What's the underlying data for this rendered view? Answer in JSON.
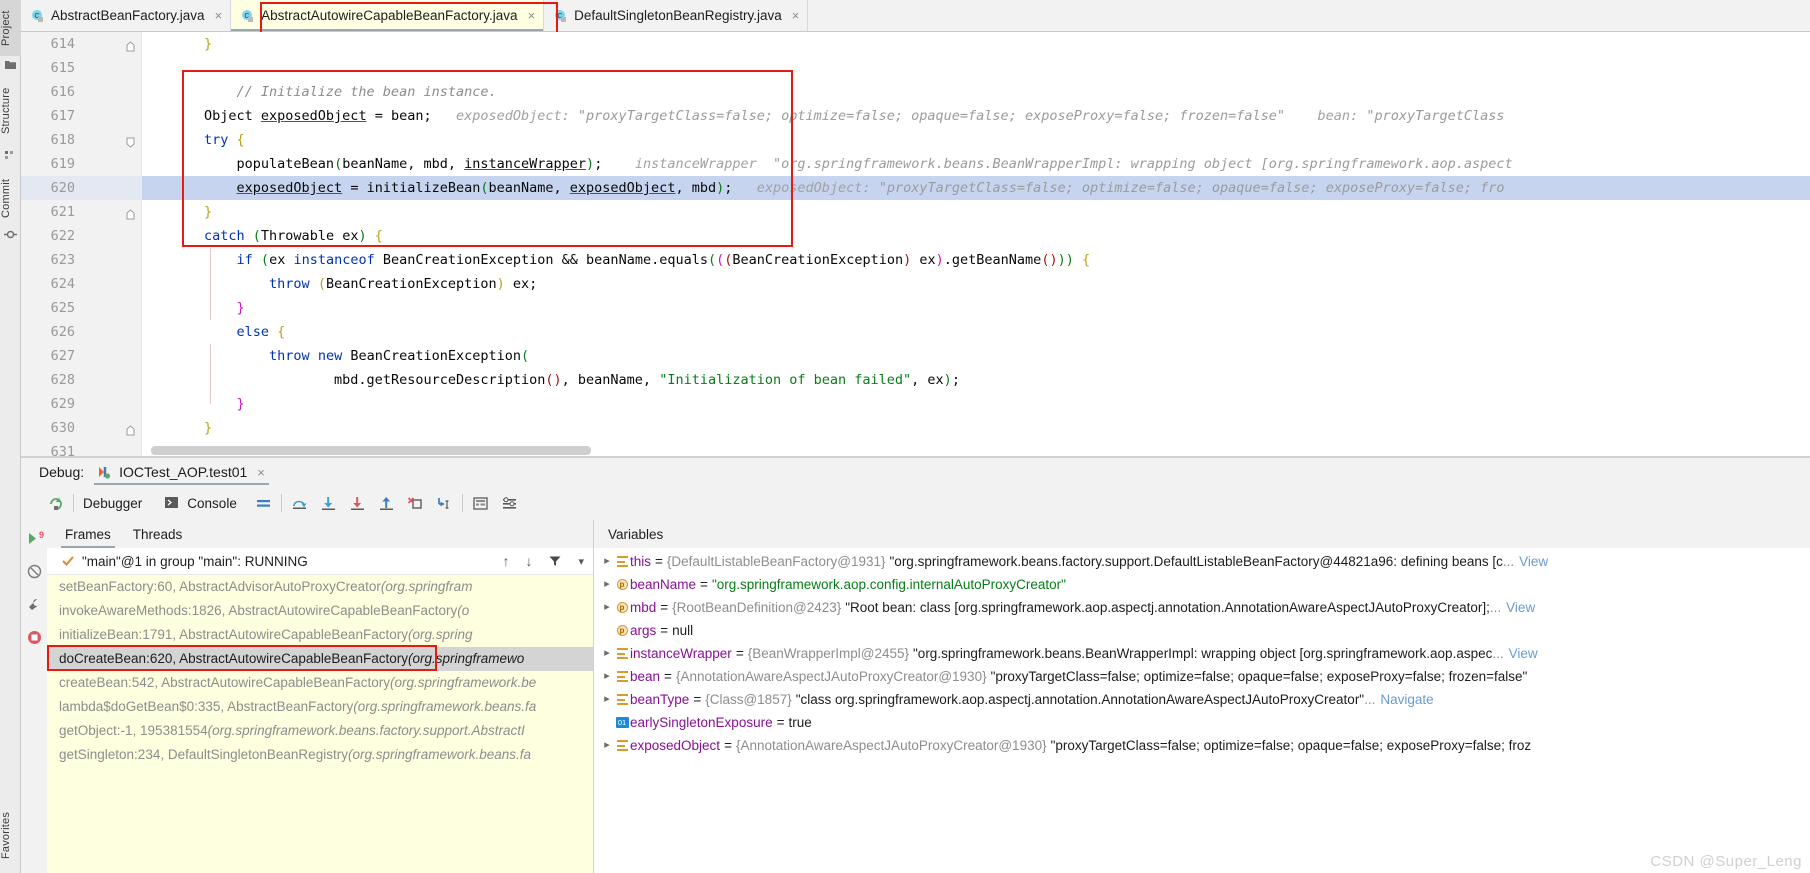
{
  "sidebar": {
    "tabs": [
      {
        "label": "Project",
        "icon": "folder-icon",
        "selected": true
      },
      {
        "label": "Structure",
        "icon": "structure-icon",
        "selected": false
      },
      {
        "label": "Commit",
        "icon": "commit-icon",
        "selected": false
      },
      {
        "label": "Favorites",
        "icon": "favorites-icon",
        "selected": false
      }
    ]
  },
  "editor": {
    "tabs": [
      {
        "label": "AbstractBeanFactory.java",
        "icon": "java-class-icon",
        "active": false,
        "close": "×"
      },
      {
        "label": "AbstractAutowireCapableBeanFactory.java",
        "icon": "java-class-icon",
        "active": true,
        "close": "×",
        "highlighted": true
      },
      {
        "label": "DefaultSingletonBeanRegistry.java",
        "icon": "java-class-icon",
        "active": false,
        "close": "×"
      }
    ],
    "line_numbers": [
      614,
      615,
      616,
      617,
      618,
      619,
      620,
      621,
      622,
      623,
      624,
      625,
      626,
      627,
      628,
      629,
      630,
      631
    ],
    "code_lines": [
      {
        "n": 614,
        "text": "    }"
      },
      {
        "n": 615,
        "text": ""
      },
      {
        "n": 616,
        "text": "    // Initialize the bean instance."
      },
      {
        "n": 617,
        "text": "    Object exposedObject = bean;"
      },
      {
        "n": 618,
        "text": "    try {"
      },
      {
        "n": 619,
        "text": "        populateBean(beanName, mbd, instanceWrapper);"
      },
      {
        "n": 620,
        "text": "        exposedObject = initializeBean(beanName, exposedObject, mbd);",
        "current": true
      },
      {
        "n": 621,
        "text": "    }"
      },
      {
        "n": 622,
        "text": "    catch (Throwable ex) {"
      },
      {
        "n": 623,
        "text": "        if (ex instanceof BeanCreationException && beanName.equals(((BeanCreationException) ex).getBeanName())) {"
      },
      {
        "n": 624,
        "text": "            throw (BeanCreationException) ex;"
      },
      {
        "n": 625,
        "text": "        }"
      },
      {
        "n": 626,
        "text": "        else {"
      },
      {
        "n": 627,
        "text": "            throw new BeanCreationException("
      },
      {
        "n": 628,
        "text": "                    mbd.getResourceDescription(), beanName, \"Initialization of bean failed\", ex);"
      },
      {
        "n": 629,
        "text": "        }"
      },
      {
        "n": 630,
        "text": "    }"
      },
      {
        "n": 631,
        "text": ""
      }
    ],
    "inline_hints": {
      "line617_a_name": "exposedObject:",
      "line617_a_value": "\"proxyTargetClass=false; optimize=false; opaque=false; exposeProxy=false; frozen=false\"",
      "line617_b_name": "bean:",
      "line617_b_value": "\"proxyTargetClass",
      "line619_name": "instanceWrapper",
      "line619_value": "\"org.springframework.beans.BeanWrapperImpl: wrapping object [org.springframework.aop.aspect",
      "line620_name": "exposedObject:",
      "line620_value": "\"proxyTargetClass=false; optimize=false; opaque=false; exposeProxy=false; fro"
    }
  },
  "debug": {
    "label": "Debug:",
    "run_config": "IOCTest_AOP.test01",
    "run_config_close": "×",
    "toolbar": {
      "rerun_icon": "rerun-icon",
      "tabs": [
        {
          "label": "Debugger",
          "icon": "debugger-icon",
          "selected": true
        },
        {
          "label": "Console",
          "icon": "console-icon",
          "selected": false
        }
      ],
      "actions": [
        {
          "name": "layout-icon",
          "title": "Layout Settings"
        },
        {
          "name": "step-over-icon",
          "title": "Step Over"
        },
        {
          "name": "step-into-icon",
          "title": "Step Into"
        },
        {
          "name": "force-step-into-icon",
          "title": "Force Step Into"
        },
        {
          "name": "step-out-icon",
          "title": "Step Out"
        },
        {
          "name": "drop-frame-icon",
          "title": "Drop Frame"
        },
        {
          "name": "run-to-cursor-icon",
          "title": "Run to Cursor"
        },
        {
          "name": "evaluate-expression-icon",
          "title": "Evaluate Expression"
        },
        {
          "name": "settings-icon",
          "title": "Settings"
        }
      ]
    },
    "left_rail": [
      {
        "name": "resume-program-icon"
      },
      {
        "name": "mute-breakpoints-icon"
      },
      {
        "name": "settings-wrench-icon"
      },
      {
        "name": "stop-icon"
      }
    ],
    "frames": {
      "tabs": [
        {
          "label": "Frames",
          "selected": true
        },
        {
          "label": "Threads",
          "selected": false
        }
      ],
      "thread": "\"main\"@1 in group \"main\": RUNNING",
      "thread_icon": "check-icon",
      "controls": [
        {
          "name": "move-up-icon",
          "glyph": "↑"
        },
        {
          "name": "move-down-icon",
          "glyph": "↓"
        },
        {
          "name": "filter-icon",
          "glyph": "filter"
        },
        {
          "name": "dropdown-icon",
          "glyph": "▾"
        }
      ],
      "items": [
        {
          "method": "setBeanFactory:60, AbstractAdvisorAutoProxyCreator",
          "pkg": "(org.springfram",
          "selected": false
        },
        {
          "method": "invokeAwareMethods:1826, AbstractAutowireCapableBeanFactory",
          "pkg": "(o",
          "selected": false
        },
        {
          "method": "initializeBean:1791, AbstractAutowireCapableBeanFactory",
          "pkg": "(org.spring",
          "selected": false
        },
        {
          "method": "doCreateBean:620, AbstractAutowireCapableBeanFactory",
          "pkg": "(org.springframewo",
          "selected": true,
          "highlighted": true
        },
        {
          "method": "createBean:542, AbstractAutowireCapableBeanFactory",
          "pkg": "(org.springframework.be",
          "selected": false
        },
        {
          "method": "lambda$doGetBean$0:335, AbstractBeanFactory",
          "pkg": "(org.springframework.beans.fa",
          "selected": false
        },
        {
          "method": "getObject:-1, 195381554",
          "pkg": "(org.springframework.beans.factory.support.AbstractI",
          "selected": false
        },
        {
          "method": "getSingleton:234, DefaultSingletonBeanRegistry",
          "pkg": "(org.springframework.beans.fa",
          "selected": false
        }
      ]
    },
    "variables": {
      "title": "Variables",
      "items": [
        {
          "expandable": true,
          "icon": "object-field-icon",
          "name": "this",
          "ref": "{DefaultListableBeanFactory@1931}",
          "value": "\"org.springframework.beans.factory.support.DefaultListableBeanFactory@44821a96: defining beans [c",
          "value_kind": "plain",
          "ellipsis": "...",
          "link": "View"
        },
        {
          "expandable": true,
          "icon": "parameter-icon",
          "name": "beanName",
          "ref": "",
          "value": "\"org.springframework.aop.config.internalAutoProxyCreator\"",
          "value_kind": "string",
          "ellipsis": "",
          "link": ""
        },
        {
          "expandable": true,
          "icon": "parameter-icon",
          "name": "mbd",
          "ref": "{RootBeanDefinition@2423}",
          "value": "\"Root bean: class [org.springframework.aop.aspectj.annotation.AnnotationAwareAspectJAutoProxyCreator];",
          "value_kind": "plain",
          "ellipsis": "...",
          "link": "View"
        },
        {
          "expandable": false,
          "icon": "parameter-icon",
          "name": "args",
          "ref": "",
          "value": "null",
          "value_kind": "null",
          "ellipsis": "",
          "link": ""
        },
        {
          "expandable": true,
          "icon": "object-field-icon",
          "name": "instanceWrapper",
          "ref": "{BeanWrapperImpl@2455}",
          "value": "\"org.springframework.beans.BeanWrapperImpl: wrapping object [org.springframework.aop.aspec",
          "value_kind": "plain",
          "ellipsis": "...",
          "link": "View"
        },
        {
          "expandable": true,
          "icon": "object-field-icon",
          "name": "bean",
          "ref": "{AnnotationAwareAspectJAutoProxyCreator@1930}",
          "value": "\"proxyTargetClass=false; optimize=false; opaque=false; exposeProxy=false; frozen=false\"",
          "value_kind": "plain",
          "ellipsis": "",
          "link": ""
        },
        {
          "expandable": true,
          "icon": "object-field-icon",
          "name": "beanType",
          "ref": "{Class@1857}",
          "value": "\"class org.springframework.aop.aspectj.annotation.AnnotationAwareAspectJAutoProxyCreator\"",
          "value_kind": "plain",
          "ellipsis": "...",
          "link": "Navigate"
        },
        {
          "expandable": false,
          "icon": "boolean-icon",
          "name": "earlySingletonExposure",
          "ref": "",
          "value": "true",
          "value_kind": "bool",
          "ellipsis": "",
          "link": ""
        },
        {
          "expandable": true,
          "icon": "object-field-icon",
          "name": "exposedObject",
          "ref": "{AnnotationAwareAspectJAutoProxyCreator@1930}",
          "value": "\"proxyTargetClass=false; optimize=false; opaque=false; exposeProxy=false; froz",
          "value_kind": "plain",
          "ellipsis": "",
          "link": ""
        }
      ]
    }
  },
  "watermark": "CSDN @Super_Leng",
  "colors": {
    "highlight_box": "#e41b13",
    "active_tab_bg": "#ffffe4",
    "current_line": "#c6d4f0",
    "frames_bg": "#feffdf",
    "selected_frame": "#d4d4d4"
  }
}
